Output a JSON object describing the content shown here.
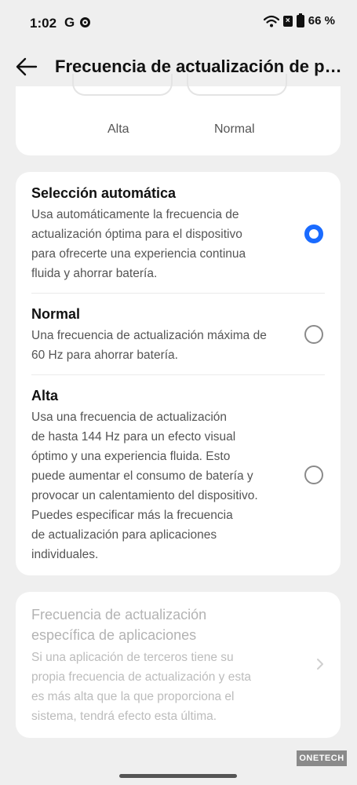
{
  "status_bar": {
    "time": "1:02",
    "g_letter": "G",
    "battery_percent": "66 %"
  },
  "app_bar": {
    "title": "Frecuencia de actualización de pa..."
  },
  "top_card": {
    "labels": [
      "Alta",
      "Normal"
    ]
  },
  "options": [
    {
      "title": "Selección automática",
      "lines": [
        "Usa automáticamente la frecuencia de",
        "actualización óptima para el dispositivo",
        "para ofrecerte una experiencia continua",
        "fluida y ahorrar batería."
      ],
      "selected": true
    },
    {
      "title": "Normal",
      "lines": [
        "Una frecuencia de actualización máxima de",
        "60 Hz para ahorrar batería."
      ],
      "selected": false
    },
    {
      "title": "Alta",
      "lines": [
        "Usa una frecuencia de actualización",
        "de hasta 144 Hz para un efecto visual",
        "óptimo y una experiencia fluida. Esto",
        "puede aumentar el consumo de batería y",
        "provocar un calentamiento del dispositivo.",
        "Puedes especificar más la frecuencia",
        "de actualización para aplicaciones",
        "individuales."
      ],
      "selected": false
    }
  ],
  "app_specific": {
    "title_lines": [
      "Frecuencia de actualización",
      "específica de aplicaciones"
    ],
    "desc_lines": [
      "Si una aplicación de terceros tiene su",
      "propia frecuencia de actualización y esta",
      "es más alta que la que proporciona el",
      "sistema, tendrá efecto esta última."
    ],
    "enabled": false
  },
  "watermark": "ONETECH",
  "colors": {
    "accent": "#1a6bff",
    "background": "#efefef",
    "card": "#ffffff"
  }
}
